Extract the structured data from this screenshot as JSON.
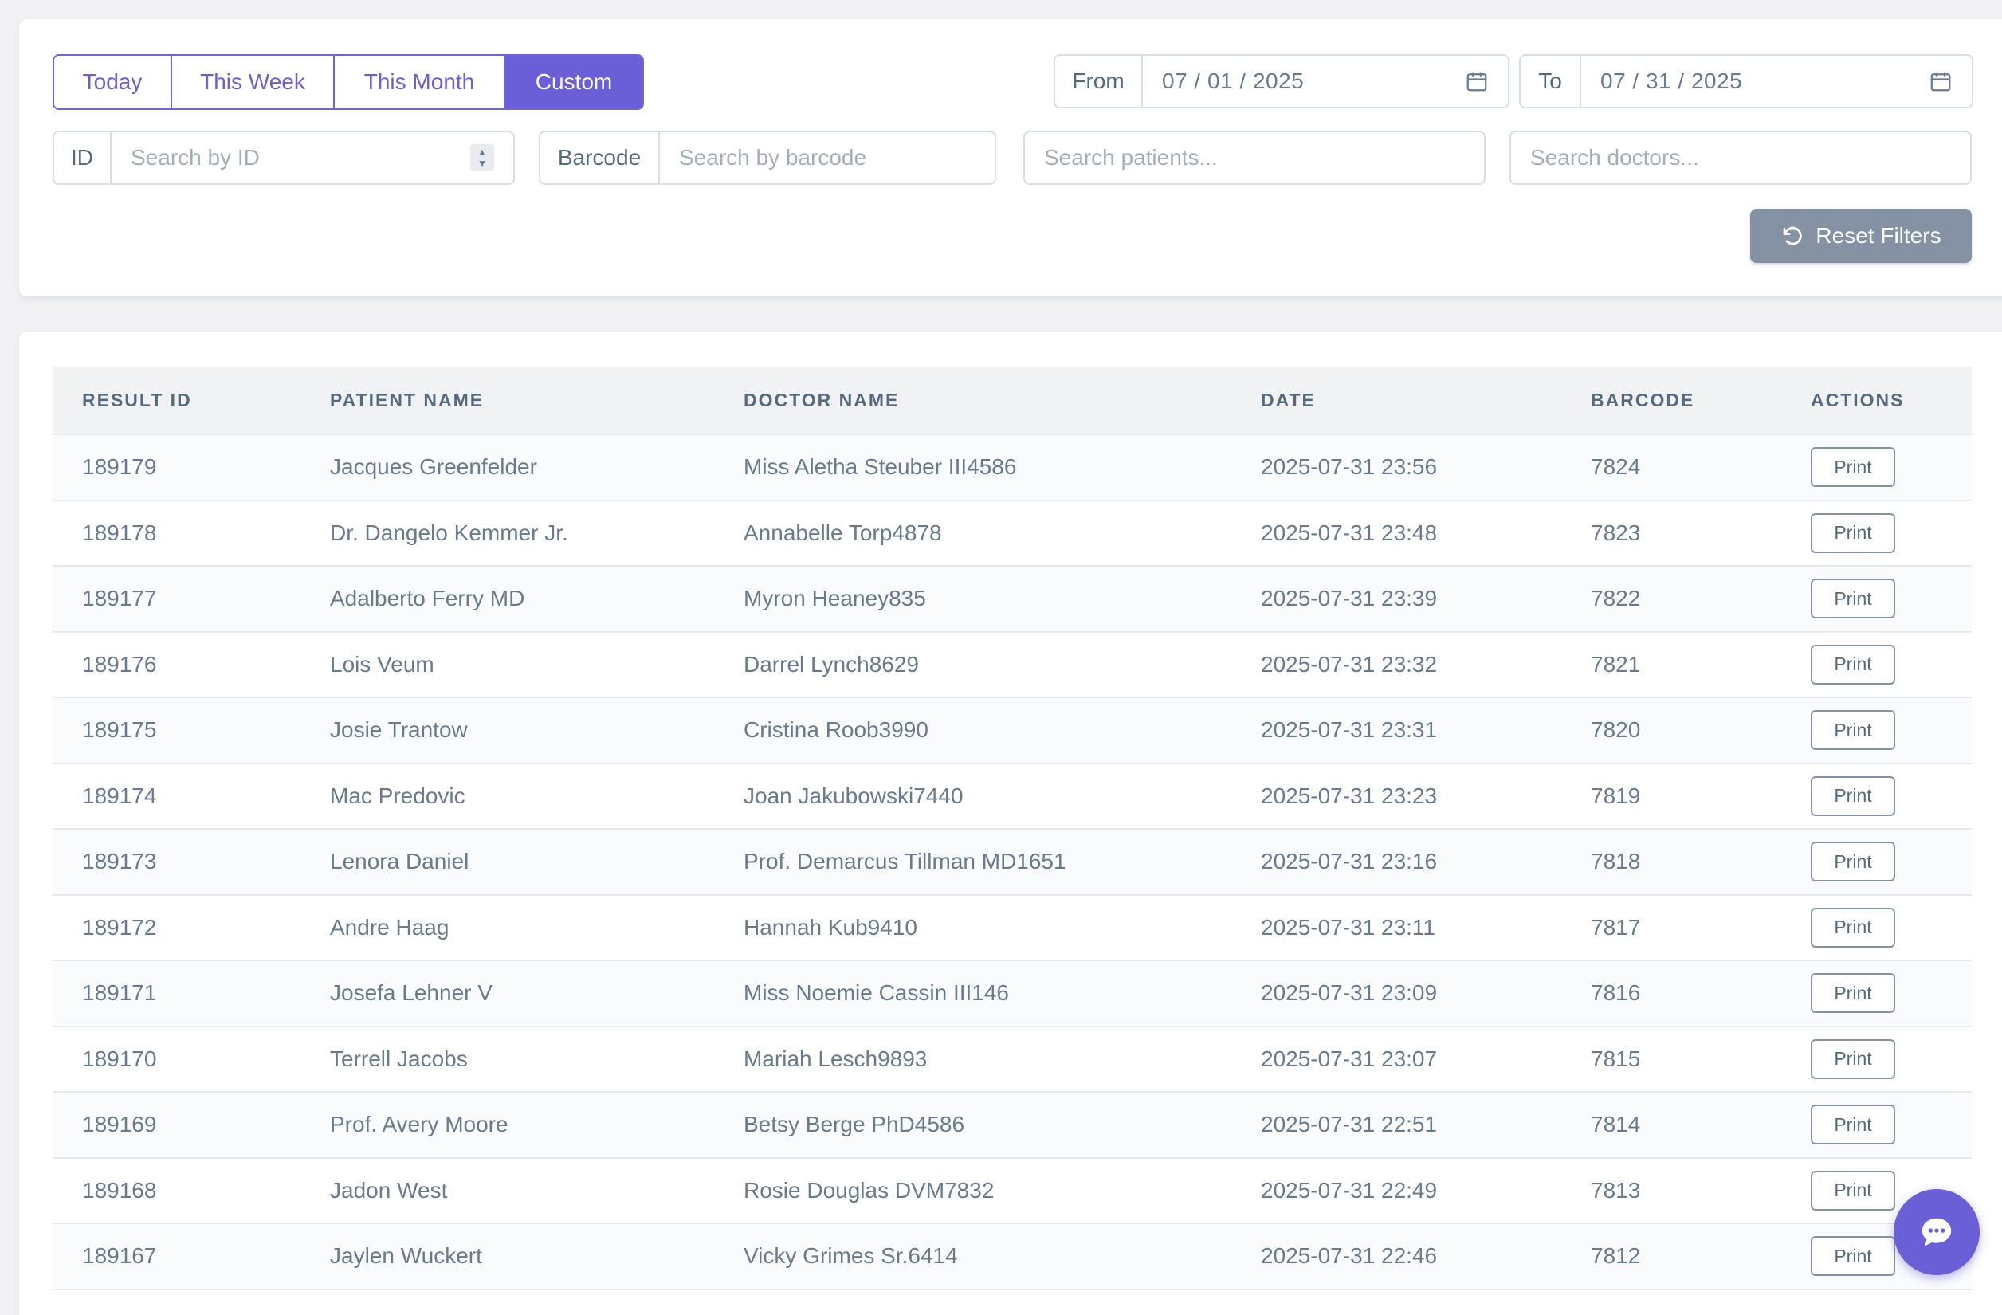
{
  "filters": {
    "periods": [
      {
        "label": "Today",
        "active": false
      },
      {
        "label": "This Week",
        "active": false
      },
      {
        "label": "This Month",
        "active": false
      },
      {
        "label": "Custom",
        "active": true
      }
    ],
    "from_label": "From",
    "from_value": "07 / 01 / 2025",
    "to_label": "To",
    "to_value": "07 / 31 / 2025",
    "id_label": "ID",
    "id_placeholder": "Search by ID",
    "barcode_label": "Barcode",
    "barcode_placeholder": "Search by barcode",
    "patients_placeholder": "Search patients...",
    "doctors_placeholder": "Search doctors...",
    "reset_label": "Reset Filters"
  },
  "table": {
    "headers": [
      "Result ID",
      "Patient Name",
      "Doctor Name",
      "Date",
      "Barcode",
      "Actions"
    ],
    "print_label": "Print",
    "rows": [
      {
        "id": "189179",
        "patient": "Jacques Greenfelder",
        "doctor": "Miss Aletha Steuber III4586",
        "date": "2025-07-31 23:56",
        "barcode": "7824"
      },
      {
        "id": "189178",
        "patient": "Dr. Dangelo Kemmer Jr.",
        "doctor": "Annabelle Torp4878",
        "date": "2025-07-31 23:48",
        "barcode": "7823"
      },
      {
        "id": "189177",
        "patient": "Adalberto Ferry MD",
        "doctor": "Myron Heaney835",
        "date": "2025-07-31 23:39",
        "barcode": "7822"
      },
      {
        "id": "189176",
        "patient": "Lois Veum",
        "doctor": "Darrel Lynch8629",
        "date": "2025-07-31 23:32",
        "barcode": "7821"
      },
      {
        "id": "189175",
        "patient": "Josie Trantow",
        "doctor": "Cristina Roob3990",
        "date": "2025-07-31 23:31",
        "barcode": "7820"
      },
      {
        "id": "189174",
        "patient": "Mac Predovic",
        "doctor": "Joan Jakubowski7440",
        "date": "2025-07-31 23:23",
        "barcode": "7819"
      },
      {
        "id": "189173",
        "patient": "Lenora Daniel",
        "doctor": "Prof. Demarcus Tillman MD1651",
        "date": "2025-07-31 23:16",
        "barcode": "7818"
      },
      {
        "id": "189172",
        "patient": "Andre Haag",
        "doctor": "Hannah Kub9410",
        "date": "2025-07-31 23:11",
        "barcode": "7817"
      },
      {
        "id": "189171",
        "patient": "Josefa Lehner V",
        "doctor": "Miss Noemie Cassin III146",
        "date": "2025-07-31 23:09",
        "barcode": "7816"
      },
      {
        "id": "189170",
        "patient": "Terrell Jacobs",
        "doctor": "Mariah Lesch9893",
        "date": "2025-07-31 23:07",
        "barcode": "7815"
      },
      {
        "id": "189169",
        "patient": "Prof. Avery Moore",
        "doctor": "Betsy Berge PhD4586",
        "date": "2025-07-31 22:51",
        "barcode": "7814"
      },
      {
        "id": "189168",
        "patient": "Jadon West",
        "doctor": "Rosie Douglas DVM7832",
        "date": "2025-07-31 22:49",
        "barcode": "7813"
      },
      {
        "id": "189167",
        "patient": "Jaylen Wuckert",
        "doctor": "Vicky Grimes Sr.6414",
        "date": "2025-07-31 22:46",
        "barcode": "7812"
      }
    ]
  },
  "icons": {
    "calendar": "calendar-icon",
    "reset": "reset-icon",
    "chat": "chat-icon"
  },
  "colors": {
    "primary": "#6a5fd6",
    "secondary": "#8592a3"
  }
}
